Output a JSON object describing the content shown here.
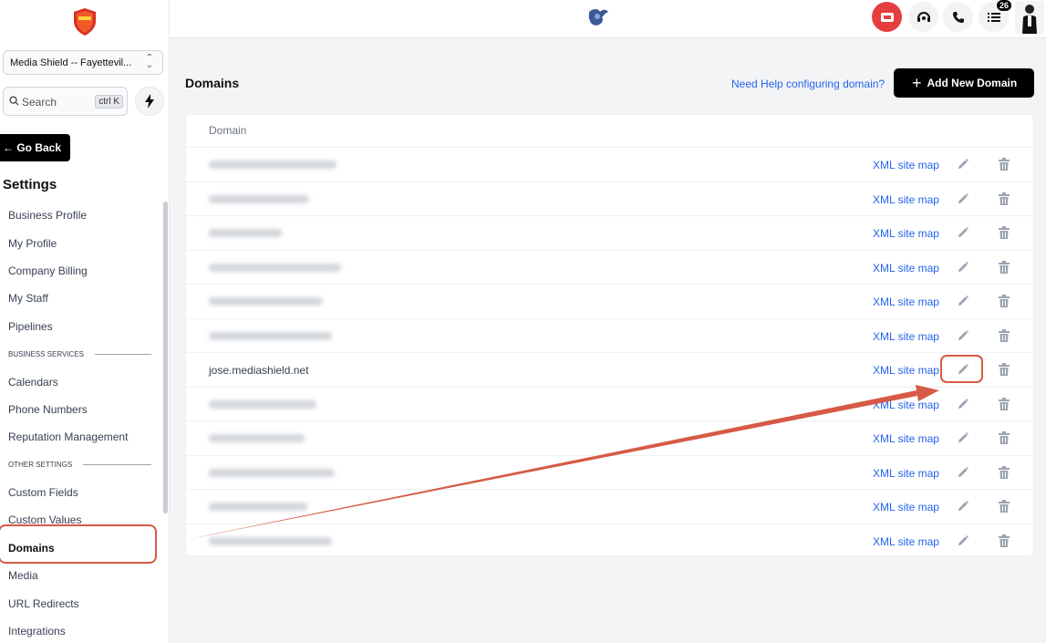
{
  "sidebar": {
    "location": "Media Shield -- Fayettevil...",
    "search_placeholder": "Search",
    "search_shortcut": "ctrl K",
    "go_back": "Go Back",
    "settings_title": "Settings",
    "items": [
      {
        "type": "item",
        "label": "Business Profile"
      },
      {
        "type": "item",
        "label": "My Profile"
      },
      {
        "type": "item",
        "label": "Company Billing"
      },
      {
        "type": "item",
        "label": "My Staff"
      },
      {
        "type": "item",
        "label": "Pipelines"
      },
      {
        "type": "section",
        "label": "BUSINESS SERVICES"
      },
      {
        "type": "item",
        "label": "Calendars"
      },
      {
        "type": "item",
        "label": "Phone Numbers"
      },
      {
        "type": "item",
        "label": "Reputation Management"
      },
      {
        "type": "section",
        "label": "OTHER SETTINGS"
      },
      {
        "type": "item",
        "label": "Custom Fields"
      },
      {
        "type": "item",
        "label": "Custom Values"
      },
      {
        "type": "item",
        "label": "Domains",
        "active": true
      },
      {
        "type": "item",
        "label": "Media"
      },
      {
        "type": "item",
        "label": "URL Redirects"
      },
      {
        "type": "item",
        "label": "Integrations"
      }
    ]
  },
  "topbar": {
    "notification_count": "26",
    "icons": [
      "ticket-icon",
      "headset-icon",
      "phone-icon",
      "list-icon"
    ]
  },
  "main": {
    "title": "Domains",
    "help_link": "Need Help configuring domain?",
    "add_button": "Add New Domain",
    "table": {
      "column_header": "Domain",
      "link_label": "XML site map",
      "rows": [
        {
          "domain": "",
          "blurred": true
        },
        {
          "domain": "",
          "blurred": true
        },
        {
          "domain": "",
          "blurred": true
        },
        {
          "domain": "",
          "blurred": true
        },
        {
          "domain": "",
          "blurred": true
        },
        {
          "domain": "",
          "blurred": true
        },
        {
          "domain": "jose.mediashield.net",
          "blurred": false
        },
        {
          "domain": "",
          "blurred": true
        },
        {
          "domain": "",
          "blurred": true
        },
        {
          "domain": "",
          "blurred": true
        },
        {
          "domain": "",
          "blurred": true
        },
        {
          "domain": "",
          "blurred": true
        }
      ]
    }
  },
  "colors": {
    "accent_link": "#2563eb",
    "annotation": "#d65a45",
    "danger": "#e53e3e"
  }
}
